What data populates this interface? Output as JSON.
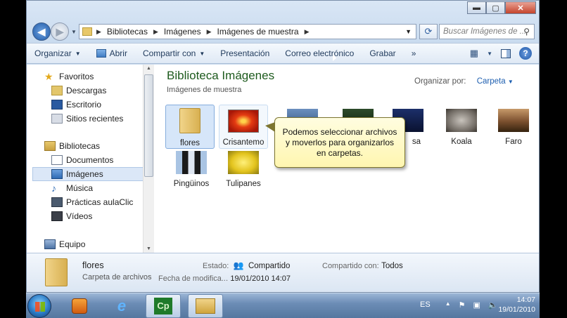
{
  "window": {
    "buttons": {
      "minimize": "▬",
      "maximize": "▢",
      "close": "✕"
    }
  },
  "address": {
    "crumbs": [
      "Bibliotecas",
      "Imágenes",
      "Imágenes de muestra"
    ],
    "search_placeholder": "Buscar Imágenes de ..."
  },
  "toolbar": {
    "organizar": "Organizar",
    "abrir": "Abrir",
    "compartir": "Compartir con",
    "presentacion": "Presentación",
    "correo": "Correo electrónico",
    "grabar": "Grabar",
    "more": "»"
  },
  "nav": {
    "favoritos": "Favoritos",
    "descargas": "Descargas",
    "escritorio": "Escritorio",
    "recientes": "Sitios recientes",
    "bibliotecas": "Bibliotecas",
    "documentos": "Documentos",
    "imagenes": "Imágenes",
    "musica": "Música",
    "practicas": "Prácticas aulaClic",
    "videos": "Vídeos",
    "equipo": "Equipo"
  },
  "content": {
    "title": "Biblioteca Imágenes",
    "subtitle": "Imágenes de muestra",
    "arrange_label": "Organizar por:",
    "arrange_value": "Carpeta",
    "items": [
      {
        "label": "flores"
      },
      {
        "label": "Crisantemo"
      },
      {
        "label": "sa"
      },
      {
        "label": "Koala"
      },
      {
        "label": "Faro"
      },
      {
        "label": "Pingüinos"
      },
      {
        "label": "Tulipanes"
      }
    ],
    "callout": "Podemos seleccionar archivos y moverlos para organizarlos en carpetas."
  },
  "details": {
    "name": "flores",
    "type": "Carpeta de archivos",
    "estado_label": "Estado:",
    "estado_value": "Compartido",
    "compartido_label": "Compartido con:",
    "compartido_value": "Todos",
    "fecha_label": "Fecha de modifica...",
    "fecha_value": "19/01/2010 14:07"
  },
  "taskbar": {
    "lang": "ES",
    "time": "14:07",
    "date": "19/01/2010",
    "cp": "Cp"
  },
  "colors": {
    "accent": "#1e5b1e",
    "link": "#1e5fb0"
  }
}
